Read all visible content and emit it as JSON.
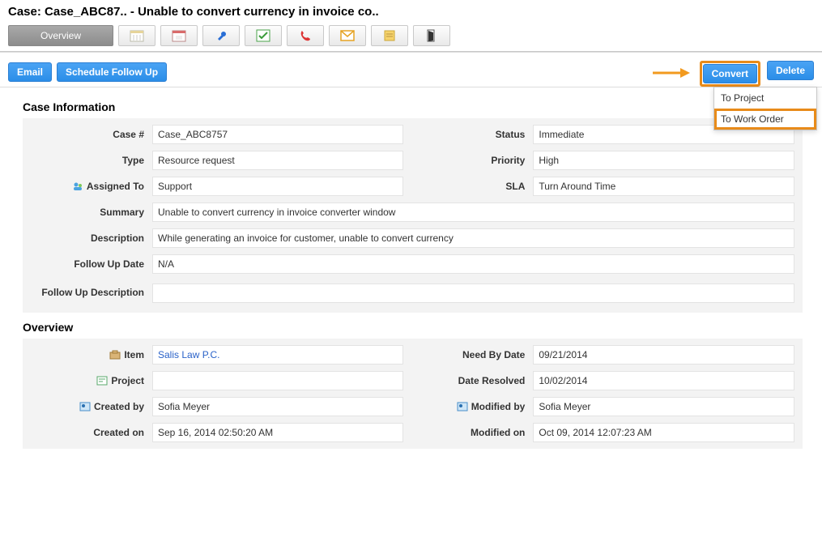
{
  "page_title": "Case: Case_ABC87.. - Unable to convert currency in invoice co..",
  "tabs": {
    "overview": "Overview"
  },
  "actions": {
    "email": "Email",
    "schedule": "Schedule Follow Up",
    "convert": "Convert",
    "delete": "Delete"
  },
  "convert_menu": {
    "to_project": "To Project",
    "to_work_order": "To Work Order"
  },
  "sections": {
    "case_info": "Case Information",
    "overview": "Overview"
  },
  "case": {
    "labels": {
      "case_no": "Case #",
      "status": "Status",
      "type": "Type",
      "priority": "Priority",
      "assigned_to": "Assigned To",
      "sla": "SLA",
      "summary": "Summary",
      "description": "Description",
      "follow_up_date": "Follow Up Date",
      "follow_up_desc": "Follow Up Description"
    },
    "values": {
      "case_no": "Case_ABC8757",
      "status": "Immediate",
      "type": "Resource request",
      "priority": "High",
      "assigned_to": "Support",
      "sla": "Turn Around Time",
      "summary": "Unable to convert currency in invoice converter window",
      "description": "While generating an invoice for customer, unable to convert currency",
      "follow_up_date": "N/A",
      "follow_up_desc": ""
    }
  },
  "overview": {
    "labels": {
      "item": "Item",
      "need_by": "Need By Date",
      "project": "Project",
      "date_resolved": "Date Resolved",
      "created_by": "Created by",
      "modified_by": "Modified by",
      "created_on": "Created on",
      "modified_on": "Modified on"
    },
    "values": {
      "item": "Salis Law P.C.",
      "need_by": "09/21/2014",
      "project": "",
      "date_resolved": "10/02/2014",
      "created_by": "Sofia Meyer",
      "modified_by": "Sofia Meyer",
      "created_on": "Sep 16, 2014 02:50:20 AM",
      "modified_on": "Oct 09, 2014 12:07:23 AM"
    }
  }
}
